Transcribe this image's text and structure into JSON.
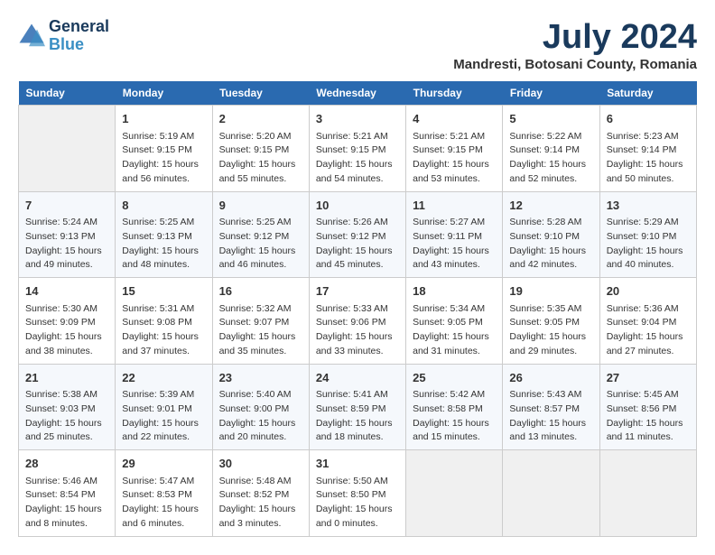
{
  "header": {
    "logo_line1": "General",
    "logo_line2": "Blue",
    "month_title": "July 2024",
    "location": "Mandresti, Botosani County, Romania"
  },
  "days_of_week": [
    "Sunday",
    "Monday",
    "Tuesday",
    "Wednesday",
    "Thursday",
    "Friday",
    "Saturday"
  ],
  "weeks": [
    [
      {
        "day": "",
        "empty": true
      },
      {
        "day": "1",
        "sunrise": "Sunrise: 5:19 AM",
        "sunset": "Sunset: 9:15 PM",
        "daylight": "Daylight: 15 hours and 56 minutes."
      },
      {
        "day": "2",
        "sunrise": "Sunrise: 5:20 AM",
        "sunset": "Sunset: 9:15 PM",
        "daylight": "Daylight: 15 hours and 55 minutes."
      },
      {
        "day": "3",
        "sunrise": "Sunrise: 5:21 AM",
        "sunset": "Sunset: 9:15 PM",
        "daylight": "Daylight: 15 hours and 54 minutes."
      },
      {
        "day": "4",
        "sunrise": "Sunrise: 5:21 AM",
        "sunset": "Sunset: 9:15 PM",
        "daylight": "Daylight: 15 hours and 53 minutes."
      },
      {
        "day": "5",
        "sunrise": "Sunrise: 5:22 AM",
        "sunset": "Sunset: 9:14 PM",
        "daylight": "Daylight: 15 hours and 52 minutes."
      },
      {
        "day": "6",
        "sunrise": "Sunrise: 5:23 AM",
        "sunset": "Sunset: 9:14 PM",
        "daylight": "Daylight: 15 hours and 50 minutes."
      }
    ],
    [
      {
        "day": "7",
        "sunrise": "Sunrise: 5:24 AM",
        "sunset": "Sunset: 9:13 PM",
        "daylight": "Daylight: 15 hours and 49 minutes."
      },
      {
        "day": "8",
        "sunrise": "Sunrise: 5:25 AM",
        "sunset": "Sunset: 9:13 PM",
        "daylight": "Daylight: 15 hours and 48 minutes."
      },
      {
        "day": "9",
        "sunrise": "Sunrise: 5:25 AM",
        "sunset": "Sunset: 9:12 PM",
        "daylight": "Daylight: 15 hours and 46 minutes."
      },
      {
        "day": "10",
        "sunrise": "Sunrise: 5:26 AM",
        "sunset": "Sunset: 9:12 PM",
        "daylight": "Daylight: 15 hours and 45 minutes."
      },
      {
        "day": "11",
        "sunrise": "Sunrise: 5:27 AM",
        "sunset": "Sunset: 9:11 PM",
        "daylight": "Daylight: 15 hours and 43 minutes."
      },
      {
        "day": "12",
        "sunrise": "Sunrise: 5:28 AM",
        "sunset": "Sunset: 9:10 PM",
        "daylight": "Daylight: 15 hours and 42 minutes."
      },
      {
        "day": "13",
        "sunrise": "Sunrise: 5:29 AM",
        "sunset": "Sunset: 9:10 PM",
        "daylight": "Daylight: 15 hours and 40 minutes."
      }
    ],
    [
      {
        "day": "14",
        "sunrise": "Sunrise: 5:30 AM",
        "sunset": "Sunset: 9:09 PM",
        "daylight": "Daylight: 15 hours and 38 minutes."
      },
      {
        "day": "15",
        "sunrise": "Sunrise: 5:31 AM",
        "sunset": "Sunset: 9:08 PM",
        "daylight": "Daylight: 15 hours and 37 minutes."
      },
      {
        "day": "16",
        "sunrise": "Sunrise: 5:32 AM",
        "sunset": "Sunset: 9:07 PM",
        "daylight": "Daylight: 15 hours and 35 minutes."
      },
      {
        "day": "17",
        "sunrise": "Sunrise: 5:33 AM",
        "sunset": "Sunset: 9:06 PM",
        "daylight": "Daylight: 15 hours and 33 minutes."
      },
      {
        "day": "18",
        "sunrise": "Sunrise: 5:34 AM",
        "sunset": "Sunset: 9:05 PM",
        "daylight": "Daylight: 15 hours and 31 minutes."
      },
      {
        "day": "19",
        "sunrise": "Sunrise: 5:35 AM",
        "sunset": "Sunset: 9:05 PM",
        "daylight": "Daylight: 15 hours and 29 minutes."
      },
      {
        "day": "20",
        "sunrise": "Sunrise: 5:36 AM",
        "sunset": "Sunset: 9:04 PM",
        "daylight": "Daylight: 15 hours and 27 minutes."
      }
    ],
    [
      {
        "day": "21",
        "sunrise": "Sunrise: 5:38 AM",
        "sunset": "Sunset: 9:03 PM",
        "daylight": "Daylight: 15 hours and 25 minutes."
      },
      {
        "day": "22",
        "sunrise": "Sunrise: 5:39 AM",
        "sunset": "Sunset: 9:01 PM",
        "daylight": "Daylight: 15 hours and 22 minutes."
      },
      {
        "day": "23",
        "sunrise": "Sunrise: 5:40 AM",
        "sunset": "Sunset: 9:00 PM",
        "daylight": "Daylight: 15 hours and 20 minutes."
      },
      {
        "day": "24",
        "sunrise": "Sunrise: 5:41 AM",
        "sunset": "Sunset: 8:59 PM",
        "daylight": "Daylight: 15 hours and 18 minutes."
      },
      {
        "day": "25",
        "sunrise": "Sunrise: 5:42 AM",
        "sunset": "Sunset: 8:58 PM",
        "daylight": "Daylight: 15 hours and 15 minutes."
      },
      {
        "day": "26",
        "sunrise": "Sunrise: 5:43 AM",
        "sunset": "Sunset: 8:57 PM",
        "daylight": "Daylight: 15 hours and 13 minutes."
      },
      {
        "day": "27",
        "sunrise": "Sunrise: 5:45 AM",
        "sunset": "Sunset: 8:56 PM",
        "daylight": "Daylight: 15 hours and 11 minutes."
      }
    ],
    [
      {
        "day": "28",
        "sunrise": "Sunrise: 5:46 AM",
        "sunset": "Sunset: 8:54 PM",
        "daylight": "Daylight: 15 hours and 8 minutes."
      },
      {
        "day": "29",
        "sunrise": "Sunrise: 5:47 AM",
        "sunset": "Sunset: 8:53 PM",
        "daylight": "Daylight: 15 hours and 6 minutes."
      },
      {
        "day": "30",
        "sunrise": "Sunrise: 5:48 AM",
        "sunset": "Sunset: 8:52 PM",
        "daylight": "Daylight: 15 hours and 3 minutes."
      },
      {
        "day": "31",
        "sunrise": "Sunrise: 5:50 AM",
        "sunset": "Sunset: 8:50 PM",
        "daylight": "Daylight: 15 hours and 0 minutes."
      },
      {
        "day": "",
        "empty": true
      },
      {
        "day": "",
        "empty": true
      },
      {
        "day": "",
        "empty": true
      }
    ]
  ]
}
